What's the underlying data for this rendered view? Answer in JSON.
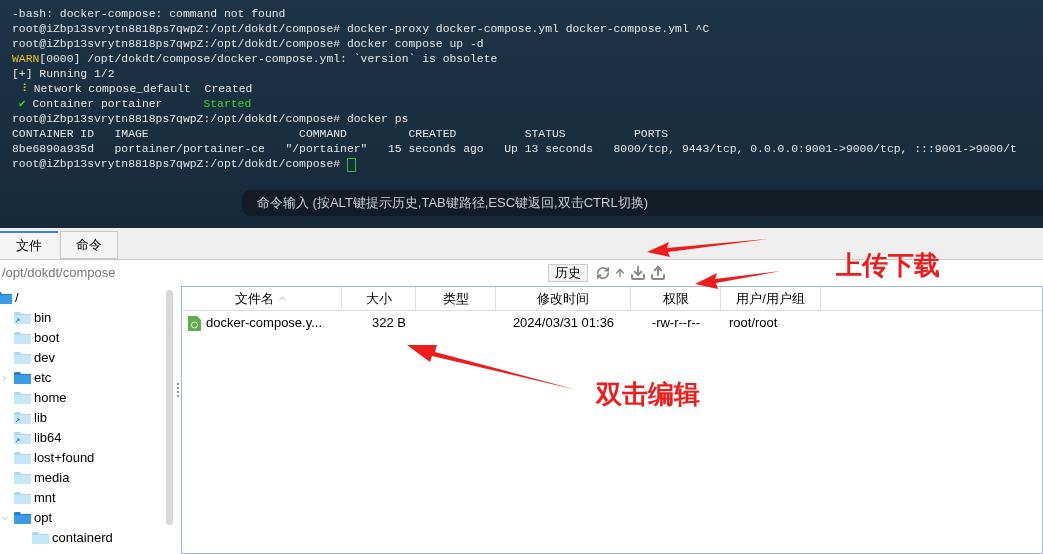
{
  "terminal": {
    "lines": [
      {
        "segments": [
          {
            "text": "-bash: docker-compose: command not found",
            "color": "#e6e6e6"
          }
        ]
      },
      {
        "segments": [
          {
            "text": "root@iZbp13svrytn8818ps7qwpZ:/opt/dokdt/compose# docker-proxy docker-compose.yml docker-compose.yml ^C",
            "color": "#e6e6e6"
          }
        ]
      },
      {
        "segments": [
          {
            "text": "root@iZbp13svrytn8818ps7qwpZ:/opt/dokdt/compose# docker compose up -d",
            "color": "#e6e6e6"
          }
        ]
      },
      {
        "segments": [
          {
            "text": "WARN",
            "color": "#e5c51a"
          },
          {
            "text": "[0000] /opt/dokdt/compose/docker-compose.yml: `version` is obsolete",
            "color": "#e6e6e6"
          }
        ]
      },
      {
        "segments": [
          {
            "text": "[+] Running 1/2",
            "color": "#e6e6e6"
          }
        ]
      },
      {
        "segments": [
          {
            "text": " ⠸",
            "color": "#e5c51a"
          },
          {
            "text": " Network compose_default  Created",
            "color": "#e6e6e6"
          }
        ]
      },
      {
        "segments": [
          {
            "text": " ✔",
            "color": "#2fd62f"
          },
          {
            "text": " Container portainer      ",
            "color": "#e6e6e6"
          },
          {
            "text": "Started",
            "color": "#2fd62f"
          }
        ]
      },
      {
        "segments": [
          {
            "text": "root@iZbp13svrytn8818ps7qwpZ:/opt/dokdt/compose# docker ps",
            "color": "#e6e6e6"
          }
        ]
      },
      {
        "segments": [
          {
            "text": "CONTAINER ID   IMAGE                      COMMAND         CREATED          STATUS          PORTS",
            "color": "#e6e6e6"
          }
        ]
      },
      {
        "segments": [
          {
            "text": "8be6890a935d   portainer/portainer-ce   \"/portainer\"   15 seconds ago   Up 13 seconds   8000/tcp, 9443/tcp, 0.0.0.0:9001->9000/tcp, :::9001->9000/t",
            "color": "#e6e6e6"
          }
        ]
      },
      {
        "segments": [
          {
            "text": "root@iZbp13svrytn8818ps7qwpZ:/opt/dokdt/compose# ",
            "color": "#e6e6e6"
          }
        ],
        "cursor": true
      }
    ],
    "command_hint": "命令输入 (按ALT键提示历史,TAB键路径,ESC键返回,双击CTRL切换)"
  },
  "tabs": [
    {
      "label": "文件",
      "selected": true
    },
    {
      "label": "命令",
      "selected": false
    }
  ],
  "path": "/opt/dokdt/compose",
  "history_button": "历史",
  "tree": [
    {
      "name": "/",
      "kind": "root",
      "children": [
        {
          "name": "bin",
          "kind": "link"
        },
        {
          "name": "boot",
          "kind": "folder"
        },
        {
          "name": "dev",
          "kind": "folder"
        },
        {
          "name": "etc",
          "kind": "branch",
          "expanded": false
        },
        {
          "name": "home",
          "kind": "folder"
        },
        {
          "name": "lib",
          "kind": "link"
        },
        {
          "name": "lib64",
          "kind": "link"
        },
        {
          "name": "lost+found",
          "kind": "folder"
        },
        {
          "name": "media",
          "kind": "folder"
        },
        {
          "name": "mnt",
          "kind": "folder"
        },
        {
          "name": "opt",
          "kind": "branch",
          "expanded": true,
          "children": [
            {
              "name": "containerd",
              "kind": "folder"
            }
          ]
        }
      ]
    }
  ],
  "table": {
    "columns": [
      {
        "label": "文件名",
        "sorted": true
      },
      {
        "label": "大小",
        "sorted": false
      },
      {
        "label": "类型",
        "sorted": false
      },
      {
        "label": "修改时间",
        "sorted": false
      },
      {
        "label": "权限",
        "sorted": false
      },
      {
        "label": "用户/用户组",
        "sorted": false
      }
    ],
    "rows": [
      {
        "cells": [
          "docker-compose.y...",
          "322 B",
          "",
          "2024/03/31 01:36",
          "-rw-r--r--",
          "root/root"
        ]
      }
    ]
  },
  "annotations": [
    {
      "text": "上传下载"
    },
    {
      "text": "双击编辑"
    }
  ]
}
